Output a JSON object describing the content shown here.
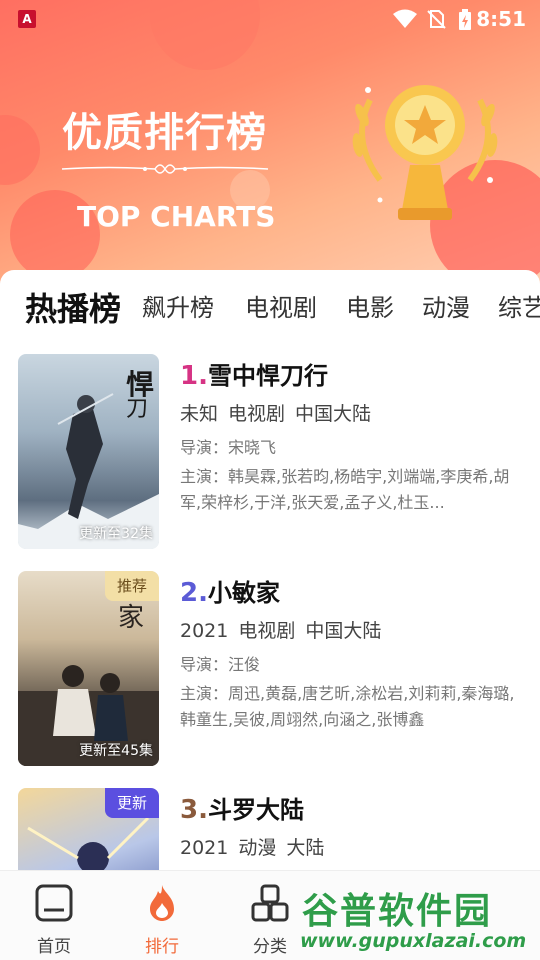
{
  "status_bar": {
    "app_badge": "A",
    "time": "8:51"
  },
  "header": {
    "title": "优质排行榜",
    "subtitle": "TOP CHARTS"
  },
  "tabs": [
    {
      "label": "热播榜",
      "active": true
    },
    {
      "label": "飙升榜",
      "active": false
    },
    {
      "label": "电视剧",
      "active": false
    },
    {
      "label": "电影",
      "active": false
    },
    {
      "label": "动漫",
      "active": false
    },
    {
      "label": "综艺",
      "active": false
    }
  ],
  "items": [
    {
      "rank": "1.",
      "rank_color": "#d63384",
      "title": "雪中悍刀行",
      "meta": [
        "未知",
        "电视剧",
        "中国大陆"
      ],
      "director": "导演：宋晓飞",
      "cast": "主演：韩昊霖,张若昀,杨皓宇,刘端端,李庚希,胡军,荣梓杉,于洋,张天爱,孟子义,杜玉...",
      "episode": "更新至32集",
      "badge": ""
    },
    {
      "rank": "2.",
      "rank_color": "#5b5bd6",
      "title": "小敏家",
      "meta": [
        "2021",
        "电视剧",
        "中国大陆"
      ],
      "director": "导演：汪俊",
      "cast": "主演：周迅,黄磊,唐艺昕,涂松岩,刘莉莉,秦海璐,韩童生,吴彼,周翊然,向涵之,张博鑫",
      "episode": "更新至45集",
      "badge": "推荐"
    },
    {
      "rank": "3.",
      "rank_color": "#8a5a3c",
      "title": "斗罗大陆",
      "meta": [
        "2021",
        "动漫",
        "大陆"
      ],
      "director": "",
      "cast": "",
      "episode": "",
      "badge": "更新"
    }
  ],
  "bottom_nav": [
    {
      "label": "首页",
      "icon": "home-icon",
      "active": false
    },
    {
      "label": "排行",
      "icon": "flame-icon",
      "active": true
    },
    {
      "label": "分类",
      "icon": "category-icon",
      "active": false
    }
  ],
  "watermark": {
    "text": "谷普软件园",
    "url": "www.gupuxlazai.com"
  },
  "colors": {
    "accent": "#f26a3a",
    "badge_recommend": "#f3dfa6",
    "badge_update": "#5b4fe0"
  }
}
